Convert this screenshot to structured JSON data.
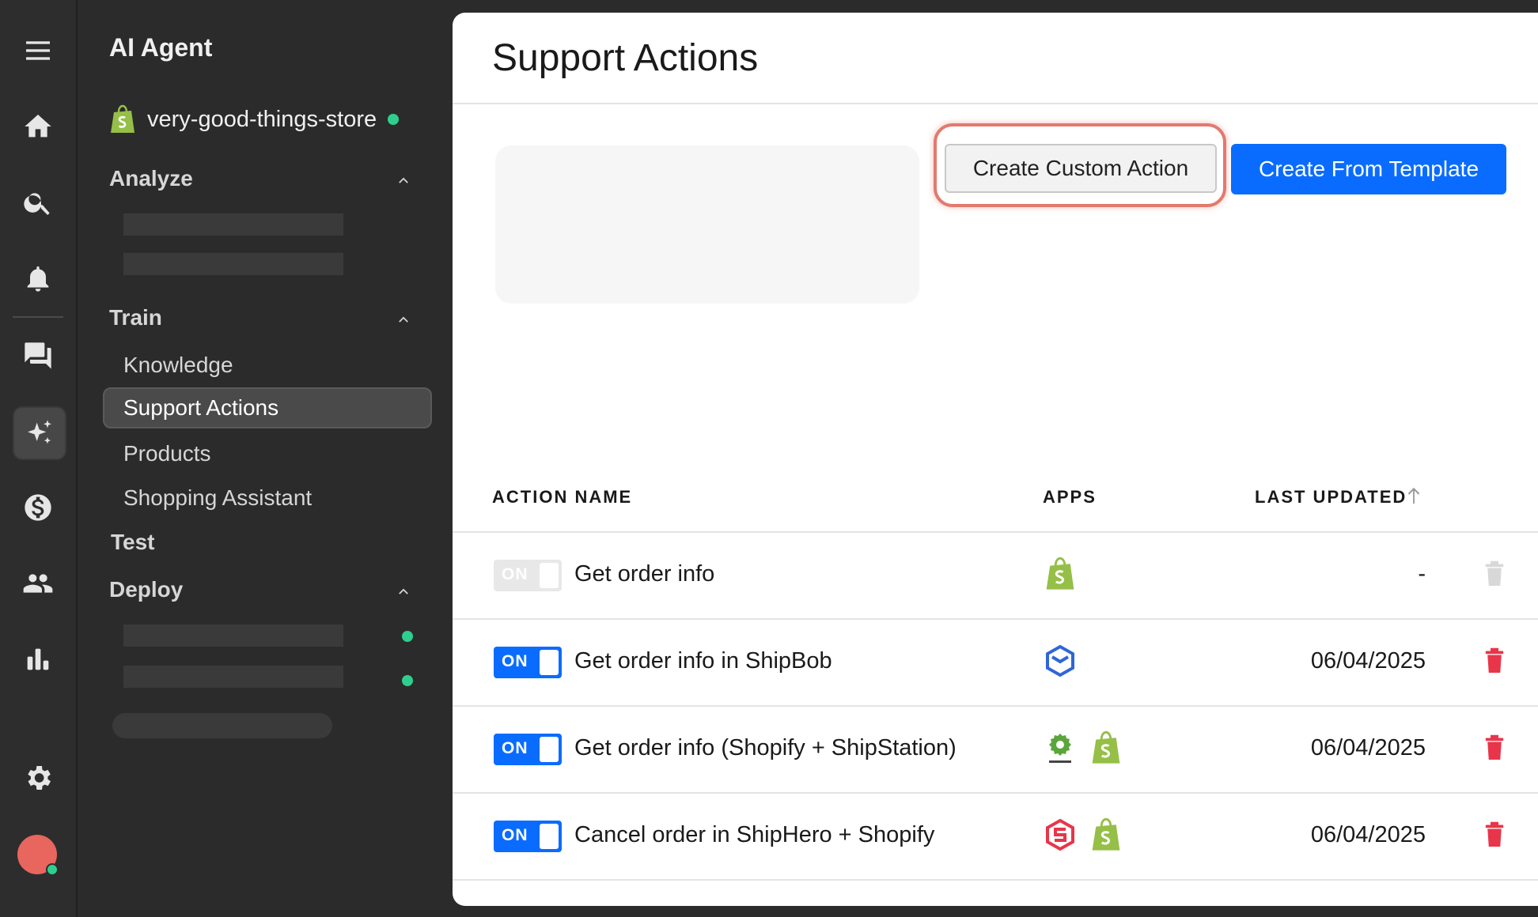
{
  "sidebar": {
    "title": "AI Agent",
    "store_name": "very-good-things-store",
    "sections": {
      "analyze": "Analyze",
      "train": "Train",
      "test": "Test",
      "deploy": "Deploy"
    },
    "train_items": [
      "Knowledge",
      "Support Actions",
      "Products",
      "Shopping Assistant"
    ],
    "active_item": "Support Actions"
  },
  "rail": {
    "icons": [
      "menu-icon",
      "home-icon",
      "search-icon",
      "bell-icon",
      "chat-icon",
      "sparkle-icon",
      "dollar-icon",
      "people-icon",
      "chart-icon",
      "gear-icon"
    ],
    "active_icon": "sparkle-icon"
  },
  "main": {
    "title": "Support Actions",
    "buttons": {
      "custom": "Create Custom Action",
      "template": "Create From Template"
    },
    "table": {
      "headers": {
        "name": "ACTION NAME",
        "apps": "APPS",
        "updated": "LAST UPDATED"
      },
      "rows": [
        {
          "toggle": "ON",
          "enabled": false,
          "name": "Get order info",
          "apps": [
            "shopify"
          ],
          "updated": "-"
        },
        {
          "toggle": "ON",
          "enabled": true,
          "name": "Get order info in ShipBob",
          "apps": [
            "shipbob"
          ],
          "updated": "06/04/2025"
        },
        {
          "toggle": "ON",
          "enabled": true,
          "name": "Get order info (Shopify + ShipStation)",
          "apps": [
            "shipstation",
            "shopify"
          ],
          "updated": "06/04/2025"
        },
        {
          "toggle": "ON",
          "enabled": true,
          "name": "Cancel order in ShipHero + Shopify",
          "apps": [
            "shiphero",
            "shopify"
          ],
          "updated": "06/04/2025"
        }
      ]
    }
  },
  "colors": {
    "accent": "#0a6cff",
    "status_green": "#2ecf8e",
    "delete_red": "#e8354a",
    "highlight": "#e27a6d"
  }
}
